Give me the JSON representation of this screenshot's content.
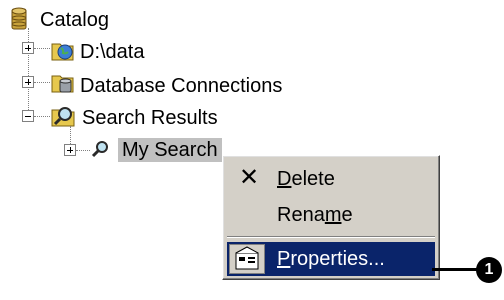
{
  "tree": {
    "root_label": "Catalog",
    "items": [
      {
        "label": "D:\\data",
        "icon": "globe-folder-icon"
      },
      {
        "label": "Database Connections",
        "icon": "database-folder-icon"
      },
      {
        "label": "Search Results",
        "icon": "search-folder-icon"
      }
    ],
    "child": {
      "label": "My Search",
      "icon": "magnifier-icon"
    }
  },
  "context_menu": {
    "items": [
      {
        "label": "Delete",
        "accelerator": "D",
        "icon": "x-delete-icon"
      },
      {
        "label": "Rename",
        "accelerator": "m"
      },
      {
        "label": "Properties...",
        "accelerator": "P",
        "icon": "properties-icon",
        "selected": true
      }
    ]
  },
  "callout": {
    "number": "1"
  },
  "colors": {
    "menu_bg": "#d4d0c8",
    "selection": "#0a246a",
    "tree_selection": "#c0c0c0"
  }
}
